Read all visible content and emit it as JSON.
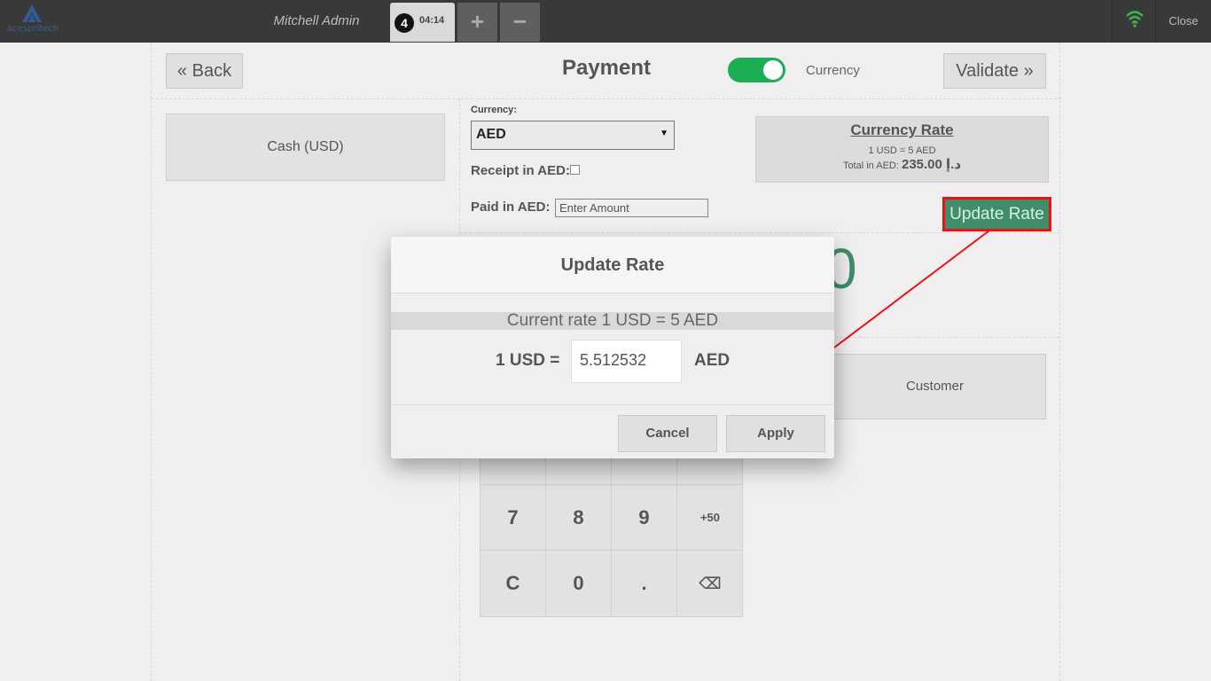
{
  "topbar": {
    "logo_text": "acespritech",
    "cashier": "Mitchell Admin",
    "order_number": "4",
    "order_time": "04:14",
    "add_label": "+",
    "remove_label": "−",
    "close_label": "Close"
  },
  "header": {
    "back_label": "Back",
    "title": "Payment",
    "toggle_on": true,
    "toggle_label": "Currency",
    "validate_label": "Validate"
  },
  "payment_lines": [
    {
      "label": "Cash (USD)"
    }
  ],
  "currency": {
    "label": "Currency:",
    "selected": "AED",
    "receipt_label": "Receipt in AED:",
    "receipt_checked": false,
    "paid_label": "Paid in AED:",
    "paid_placeholder": "Enter Amount"
  },
  "rate_box": {
    "title": "Currency Rate",
    "line": "1 USD = 5 AED",
    "total_label": "Total in AED:",
    "total_value": "235.00 د.إ",
    "update_label": "Update Rate"
  },
  "due_partial": "0",
  "customer_label": "Customer",
  "numpad": {
    "rows": [
      [
        "7",
        "8",
        "9",
        "+50"
      ],
      [
        "C",
        "0",
        ".",
        "⌫"
      ]
    ]
  },
  "dialog": {
    "title": "Update Rate",
    "current": "Current rate 1 USD = 5 AED",
    "left_label": "1 USD =",
    "rate_value": "5.512532",
    "right_label": "AED",
    "cancel_label": "Cancel",
    "apply_label": "Apply"
  },
  "colors": {
    "accent_green": "#3f8d6a",
    "toggle_green": "#1cae55",
    "highlight_red": "#ee1111",
    "topbar": "#393939"
  }
}
